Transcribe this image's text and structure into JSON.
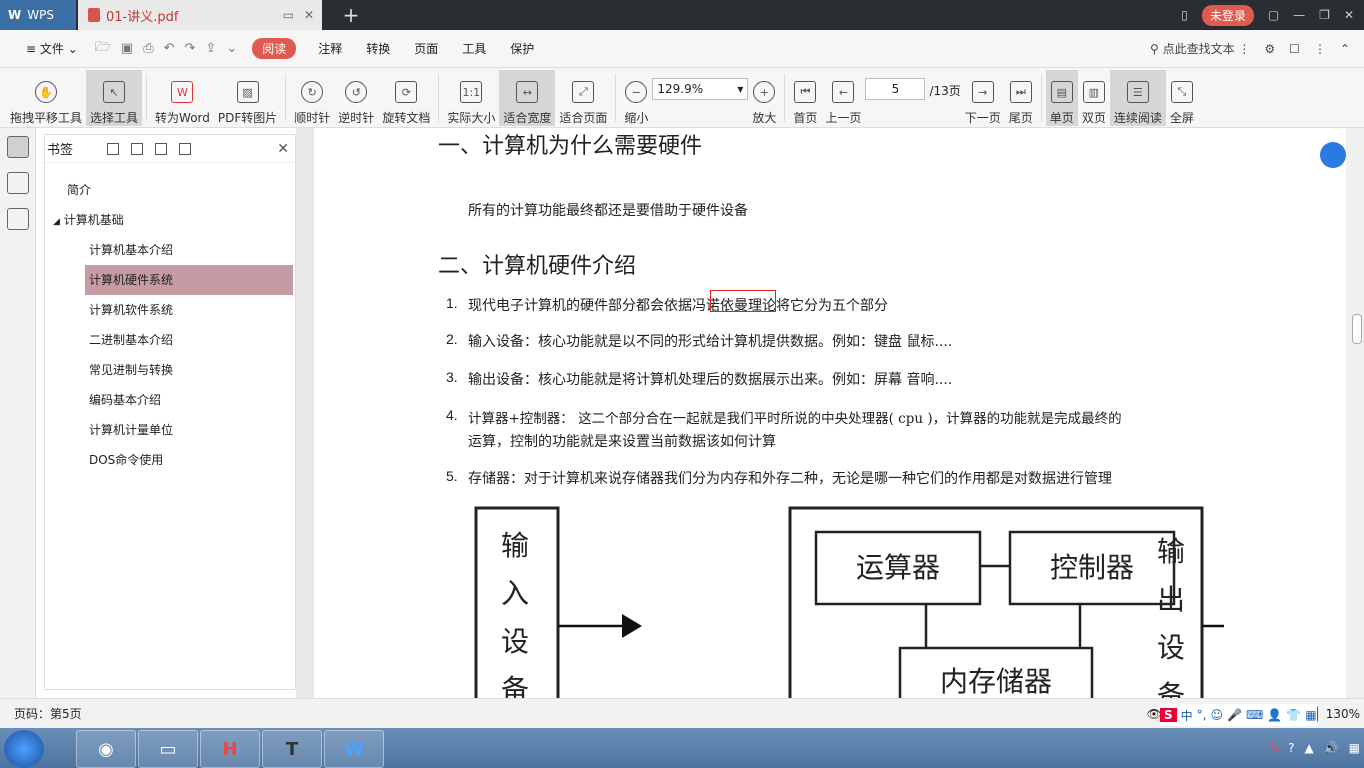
{
  "titlebar": {
    "app_tab": "WPS",
    "doc_tab": "01-讲义.pdf",
    "new_tab": "+",
    "login": "未登录"
  },
  "menu": {
    "file": "文件",
    "items": [
      "阅读",
      "注释",
      "转换",
      "页面",
      "工具",
      "保护"
    ],
    "search": "点此查找文本"
  },
  "toolbar": {
    "pan": "拖拽平移工具",
    "select": "选择工具",
    "to_word": "转为Word",
    "pdf_to_image": "PDF转图片",
    "clockwise": "顺时针",
    "counterclockwise": "逆时针",
    "rotate_doc": "旋转文档",
    "actual_size": "实际大小",
    "fit_width": "适合宽度",
    "fit_page": "适合页面",
    "zoom_out": "缩小",
    "zoom_value": "129.9%",
    "zoom_in": "放大",
    "first_page": "首页",
    "prev_page": "上一页",
    "page_current": "5",
    "page_total": "/13页",
    "next_page": "下一页",
    "last_page": "尾页",
    "single": "单页",
    "double": "双页",
    "continuous": "连续阅读",
    "fullscreen": "全屏"
  },
  "bookmarks": {
    "title": "书签",
    "items": [
      {
        "label": "简介"
      },
      {
        "label": "计算机基础"
      },
      {
        "label": "计算机基本介绍"
      },
      {
        "label": "计算机硬件系统"
      },
      {
        "label": "计算机软件系统"
      },
      {
        "label": "二进制基本介绍"
      },
      {
        "label": "常见进制与转换"
      },
      {
        "label": "编码基本介绍"
      },
      {
        "label": "计算机计量单位"
      },
      {
        "label": "DOS命令使用"
      }
    ]
  },
  "document": {
    "h1": "一、计算机为什么需要硬件",
    "p1": "所有的计算功能最终都还是要借助于硬件设备",
    "h2": "二、计算机硬件介绍",
    "list": [
      {
        "num": "1.",
        "text": "现代电子计算机的硬件部分都会依据冯诺依曼理论将它分为五个部分"
      },
      {
        "num": "2.",
        "text": "输入设备：核心功能就是以不同的形式给计算机提供数据。例如：键盘 鼠标...."
      },
      {
        "num": "3.",
        "text": "输出设备：核心功能就是将计算机处理后的数据展示出来。例如：屏幕 音响...."
      },
      {
        "num": "4.",
        "text": "计算器+控制器： 这二个部分合在一起就是我们平时所说的中央处理器( cpu )，计算器的功能就是完成最终的",
        "text2": "运算，控制的功能就是来设置当前数据该如何计算"
      },
      {
        "num": "5.",
        "text": "存储器：对于计算机来说存储器我们分为内存和外存二种，无论是哪一种它们的作用都是对数据进行管理"
      }
    ],
    "diagram": {
      "input": "输入设备",
      "alu": "运算器",
      "control": "控制器",
      "memory": "内存储器",
      "output": "输出设备"
    }
  },
  "status": {
    "page": "页码：第5页",
    "zoom": "130%"
  },
  "ime": {
    "items": [
      "S",
      "中",
      "°,"
    ]
  }
}
